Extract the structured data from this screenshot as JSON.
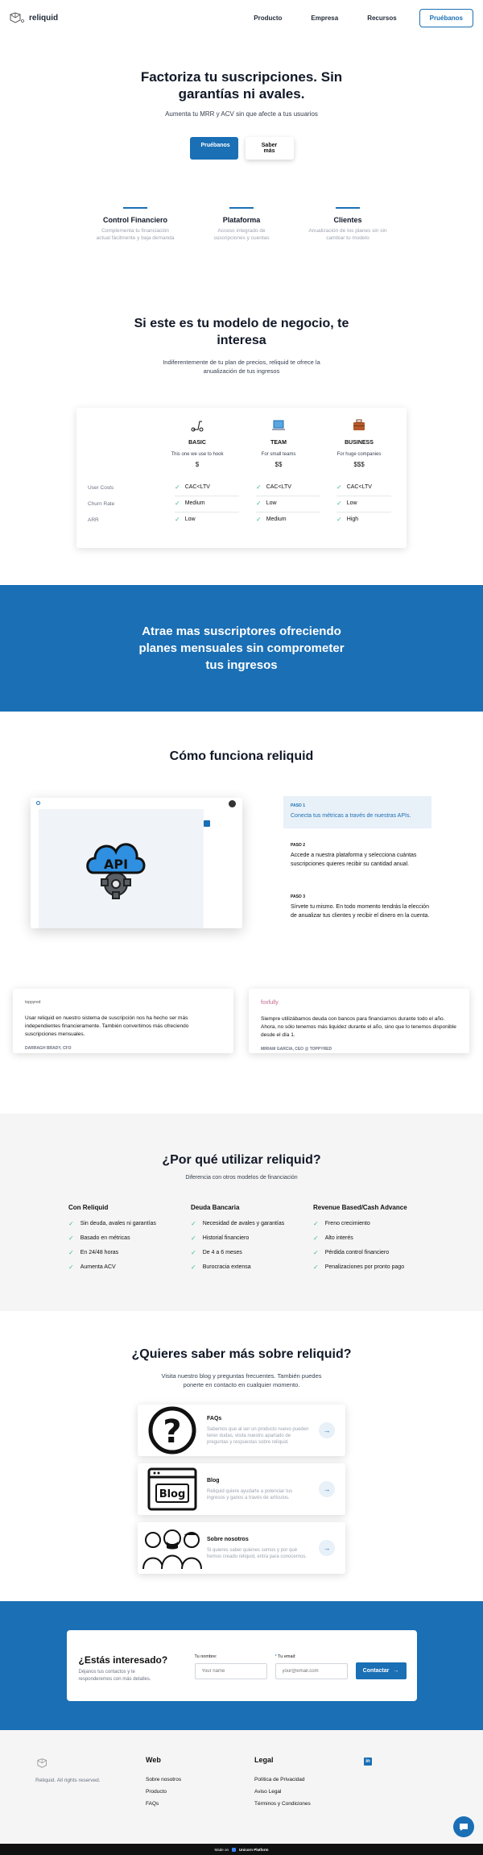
{
  "nav": {
    "logo_text": "reliquid",
    "links": [
      "Producto",
      "Empresa",
      "Recursos"
    ],
    "cta": "Pruébanos"
  },
  "hero": {
    "title": "Factoriza tu suscripciones. Sin garantías ni avales.",
    "subtitle": "Aumenta tu MRR y ACV sin que afecte a tus usuarios",
    "primary_button": "Pruébanos",
    "secondary_button": "Saber más"
  },
  "features": [
    {
      "title": "Control Financiero",
      "desc": "Complementa tu financiación actual fácilmente y baja demanda"
    },
    {
      "title": "Plataforma",
      "desc": "Acceso integrado de suscripciones y cuentas"
    },
    {
      "title": "Clientes",
      "desc": "Anualización de los planes sin sin cambiar tu modelo"
    }
  ],
  "model": {
    "title": "Si este es tu modelo de negocio, te interesa",
    "subtitle": "Indiferentemente de tu plan de precios, reliquid te ofrece la anualización de tus ingresos"
  },
  "pricing": {
    "plans": [
      {
        "name": "BASIC",
        "desc": "This one we use to hook",
        "price": "$",
        "icon": "scooter-icon"
      },
      {
        "name": "TEAM",
        "desc": "For small teams",
        "price": "$$",
        "icon": "laptop-icon"
      },
      {
        "name": "BUSINESS",
        "desc": "For huge companies",
        "price": "$$$",
        "icon": "briefcase-icon"
      }
    ],
    "rows": [
      {
        "label": "User Costs",
        "values": [
          "CAC<LTV",
          "CAC<LTV",
          "CAC<LTV"
        ]
      },
      {
        "label": "Churn Rate",
        "values": [
          "Medium",
          "Low",
          "Low"
        ]
      },
      {
        "label": "ARR",
        "values": [
          "Low",
          "Medium",
          "High"
        ]
      }
    ]
  },
  "banner": {
    "title": "Atrae mas suscriptores ofreciendo planes mensuales sin comprometer tus ingresos"
  },
  "how": {
    "title": "Cómo funciona reliquid",
    "mock_badge": "API",
    "steps": [
      {
        "label": "PASO 1",
        "text": "Conecta tus métricas a través de nuestras APIs."
      },
      {
        "label": "PASO 2",
        "text": "Accede a nuestra plataforma y selecciona cuántas suscripciones quieres recibir su cantidad anual."
      },
      {
        "label": "PASO 3",
        "text": "Sírvete tu mismo. En todo momento tendrás la elección de anualizar tus clientes y recibir el dinero en la cuenta."
      }
    ]
  },
  "testimonials": [
    {
      "logo": "toppyred",
      "quote": "Usar reliquid en nuestro sistema de suscripción nos ha hecho ser más independientes financieramente. También convertimos más ofreciendo suscripciones mensuales.",
      "author": "DARRAGH BRADY, CFO"
    },
    {
      "logo": "foxfully",
      "quote": "Siempre utilizábamos deuda con bancos para financiarnos durante todo el año. Ahora, no sólo tenemos más liquidez durante el año, sino que lo tenemos disponible desde el día 1.",
      "author": "MIRIAM GARCIA, CEO @ TOPPYRED"
    }
  ],
  "why": {
    "title": "¿Por qué utilizar reliquid?",
    "subtitle": "Diferencia con otros modelos de financiación",
    "columns": [
      {
        "title": "Con Reliquid",
        "items": [
          "Sin deuda, avales ni garantías",
          "Basado en métricas",
          "En 24/48 horas",
          "Aumenta ACV"
        ]
      },
      {
        "title": "Deuda Bancaria",
        "items": [
          "Necesidad de avales y garantías",
          "Historial financiero",
          "De 4 a 6 meses",
          "Burocracia extensa"
        ]
      },
      {
        "title": "Revenue Based/Cash Advance",
        "items": [
          "Freno crecimiento",
          "Alto interés",
          "Pérdida control financiero",
          "Penalizaciones por pronto pago"
        ]
      }
    ]
  },
  "more": {
    "title": "¿Quieres saber más sobre reliquid?",
    "subtitle": "Visita nuestro blog y preguntas frecuentes. También puedes ponerte en contacto en cualquier momento.",
    "cards": [
      {
        "title": "FAQs",
        "desc": "Sabemos que al ser un producto nuevo pueden tener dudas, visita nuestro apartado de preguntas y respuestas sobre reliquid.",
        "icon": "question-icon"
      },
      {
        "title": "Blog",
        "desc": "Reliquid quiere ayudarte a potenciar tus ingresos y ganos a través de artículos.",
        "icon": "blog-icon"
      },
      {
        "title": "Sobre nosotros",
        "desc": "Si quieres saber quienes somos y por qué hemos creado reliquid, entra para conocernos.",
        "icon": "team-icon"
      }
    ]
  },
  "cta": {
    "title": "¿Estás interesado?",
    "desc": "Déjanos tus contactos y te responderemos con más detalles.",
    "name_label": "Tu nombre:",
    "name_placeholder": "Your name",
    "email_label": "Tu email:",
    "email_placeholder": "your@email.com",
    "button": "Contactar"
  },
  "footer": {
    "rights": "Reliquid. All rights reserved.",
    "web_title": "Web",
    "web_links": [
      "Sobre nosotros",
      "Producto",
      "FAQs"
    ],
    "legal_title": "Legal",
    "legal_links": [
      "Política de Privacidad",
      "Aviso Legal",
      "Términos y Condiciones"
    ],
    "made_by_prefix": "Made on",
    "made_by_name": "Unicorn Platform"
  },
  "colors": {
    "primary": "#1a6fb5",
    "check": "#3fb6a1"
  }
}
